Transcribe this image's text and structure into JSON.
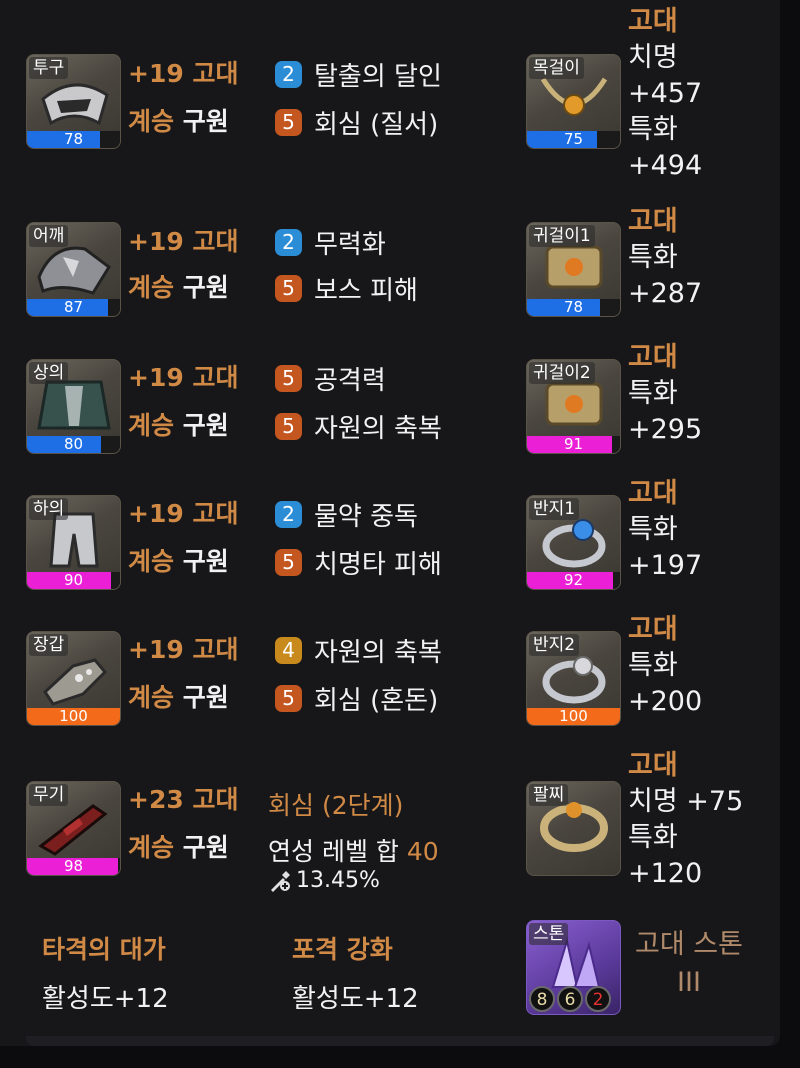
{
  "colors": {
    "accent": "#d08a46",
    "quality_blue": "#1e6fe6",
    "quality_magenta": "#ea1fd6",
    "quality_orange": "#f26a1a"
  },
  "gear": [
    {
      "slot": "투구",
      "quality": 78,
      "quality_color": "#1e6fe6",
      "enhance": "+19 고대",
      "grade_prefix": "계승",
      "grade_name": "구원",
      "engravings": [
        {
          "level": "2",
          "color": "blue",
          "name": "탈출의 달인"
        },
        {
          "level": "5",
          "color": "orange",
          "name": "회심 (질서)"
        }
      ]
    },
    {
      "slot": "어깨",
      "quality": 87,
      "quality_color": "#1e6fe6",
      "enhance": "+19 고대",
      "grade_prefix": "계승",
      "grade_name": "구원",
      "engravings": [
        {
          "level": "2",
          "color": "blue",
          "name": "무력화"
        },
        {
          "level": "5",
          "color": "orange",
          "name": "보스 피해"
        }
      ]
    },
    {
      "slot": "상의",
      "quality": 80,
      "quality_color": "#1e6fe6",
      "enhance": "+19 고대",
      "grade_prefix": "계승",
      "grade_name": "구원",
      "engravings": [
        {
          "level": "5",
          "color": "orange",
          "name": "공격력"
        },
        {
          "level": "5",
          "color": "orange",
          "name": "자원의 축복"
        }
      ]
    },
    {
      "slot": "하의",
      "quality": 90,
      "quality_color": "#ea1fd6",
      "enhance": "+19 고대",
      "grade_prefix": "계승",
      "grade_name": "구원",
      "engravings": [
        {
          "level": "2",
          "color": "blue",
          "name": "물약 중독"
        },
        {
          "level": "5",
          "color": "orange",
          "name": "치명타 피해"
        }
      ]
    },
    {
      "slot": "장갑",
      "quality": 100,
      "quality_color": "#f26a1a",
      "enhance": "+19 고대",
      "grade_prefix": "계승",
      "grade_name": "구원",
      "engravings": [
        {
          "level": "4",
          "color": "gold",
          "name": "자원의 축복"
        },
        {
          "level": "5",
          "color": "orange",
          "name": "회심 (혼돈)"
        }
      ]
    }
  ],
  "weapon": {
    "slot": "무기",
    "quality": 98,
    "quality_color": "#ea1fd6",
    "enhance": "+23 고대",
    "grade_prefix": "계승",
    "grade_name": "구원",
    "effect": "회심 (2단계)",
    "refine_label": "연성 레벨 합",
    "refine_value": "40",
    "bonus": "13.45%"
  },
  "accessories": [
    {
      "slot": "목걸이",
      "quality": 75,
      "quality_color": "#1e6fe6",
      "grade": "고대",
      "stats": [
        "치명",
        "+457",
        "특화",
        "+494"
      ]
    },
    {
      "slot": "귀걸이1",
      "quality": 78,
      "quality_color": "#1e6fe6",
      "grade": "고대",
      "stats": [
        "특화",
        "+287"
      ]
    },
    {
      "slot": "귀걸이2",
      "quality": 91,
      "quality_color": "#ea1fd6",
      "grade": "고대",
      "stats": [
        "특화",
        "+295"
      ]
    },
    {
      "slot": "반지1",
      "quality": 92,
      "quality_color": "#ea1fd6",
      "grade": "고대",
      "stats": [
        "특화",
        "+197"
      ]
    },
    {
      "slot": "반지2",
      "quality": 100,
      "quality_color": "#f26a1a",
      "grade": "고대",
      "stats": [
        "특화",
        "+200"
      ]
    },
    {
      "slot": "팔찌",
      "grade": "고대",
      "stats": [
        "치명 +75",
        "특화",
        "+120"
      ]
    }
  ],
  "abilities": [
    {
      "name": "타격의 대가",
      "value": "활성도+12"
    },
    {
      "name": "포격 강화",
      "value": "활성도+12"
    }
  ],
  "stone": {
    "slot": "스톤",
    "name_line1": "고대 스톤",
    "name_line2": "III",
    "values": [
      "8",
      "6",
      "2"
    ]
  }
}
